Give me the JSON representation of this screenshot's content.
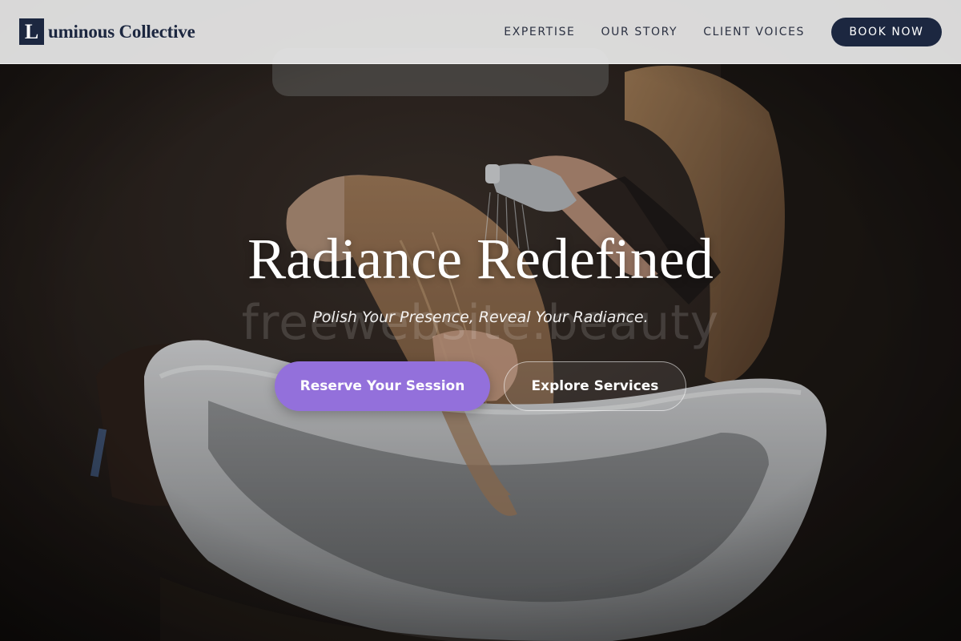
{
  "brand": {
    "mark": "L",
    "name": "uminous Collective",
    "color": "#1c2740"
  },
  "nav": {
    "items": [
      {
        "label": "EXPERTISE"
      },
      {
        "label": "OUR STORY"
      },
      {
        "label": "CLIENT VOICES"
      }
    ],
    "book_label": "BOOK NOW"
  },
  "hero": {
    "title": "Radiance Redefined",
    "subtitle": "Polish Your Presence, Reveal Your Radiance.",
    "watermark": "freewebsite.beauty",
    "primary_cta": "Reserve Your Session",
    "secondary_cta": "Explore Services",
    "background_image": "salon-hair-wash-photo"
  },
  "colors": {
    "accent": "#9370db",
    "header_bg": "#e8e8e8",
    "navy": "#1c2740"
  }
}
